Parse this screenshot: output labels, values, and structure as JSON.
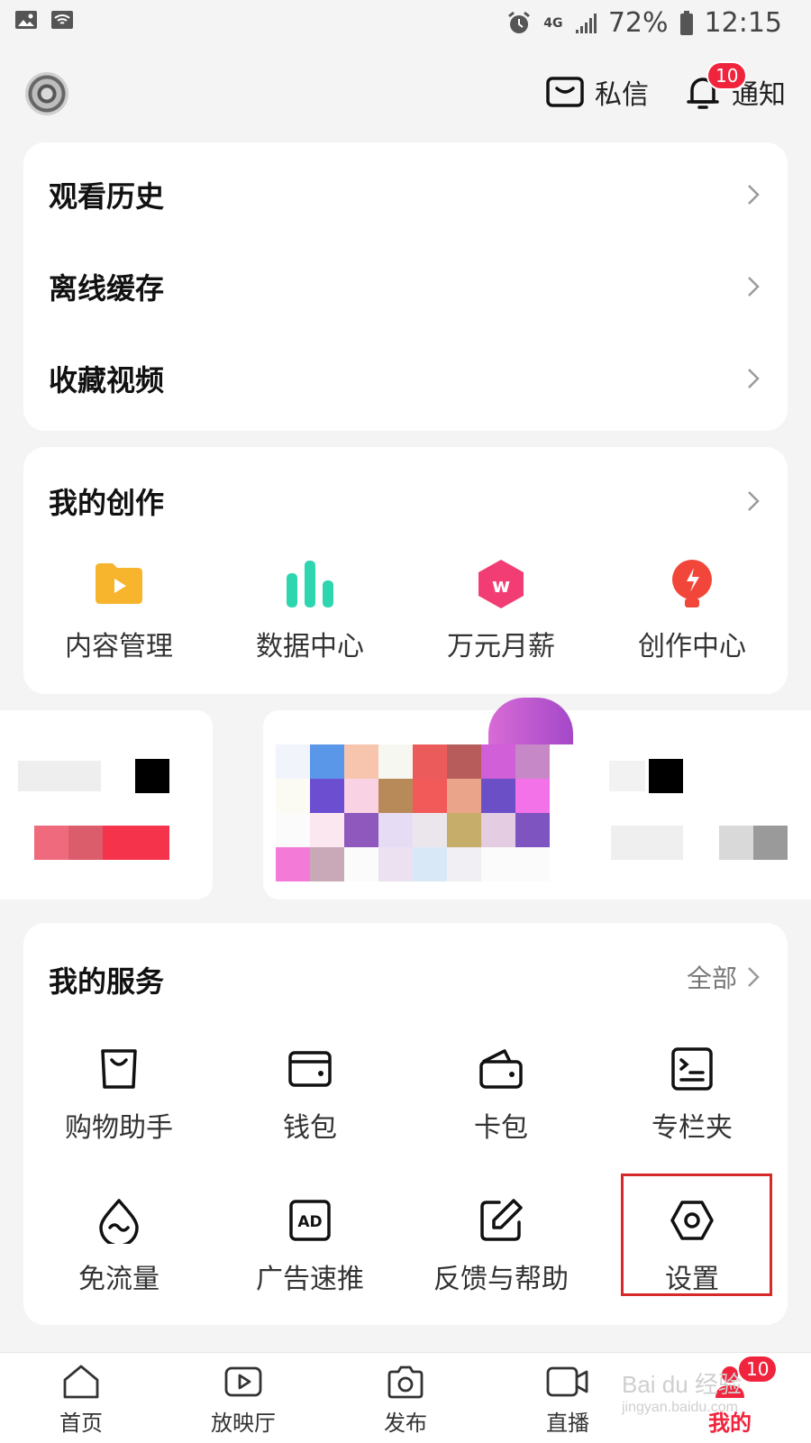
{
  "status_bar": {
    "battery": "72%",
    "time": "12:15",
    "network": "4G"
  },
  "header": {
    "messages_label": "私信",
    "notifications_label": "通知",
    "notifications_badge": "10"
  },
  "history_card": {
    "items": [
      {
        "label": "观看历史"
      },
      {
        "label": "离线缓存"
      },
      {
        "label": "收藏视频"
      }
    ]
  },
  "creation": {
    "title": "我的创作",
    "items": [
      {
        "label": "内容管理",
        "icon": "folder-play-icon",
        "color": "#f7b52e"
      },
      {
        "label": "数据中心",
        "icon": "bar-chart-icon",
        "color": "#2ed6b0"
      },
      {
        "label": "万元月薪",
        "icon": "w-hexagon-icon",
        "color": "#f23d74"
      },
      {
        "label": "创作中心",
        "icon": "lightbulb-icon",
        "color": "#f2463a"
      }
    ]
  },
  "services": {
    "title": "我的服务",
    "all_label": "全部",
    "items": [
      {
        "label": "购物助手",
        "icon": "shopping-bag-icon"
      },
      {
        "label": "钱包",
        "icon": "wallet-icon"
      },
      {
        "label": "卡包",
        "icon": "card-wallet-icon"
      },
      {
        "label": "专栏夹",
        "icon": "column-folder-icon"
      },
      {
        "label": "免流量",
        "icon": "water-drop-icon"
      },
      {
        "label": "广告速推",
        "icon": "ad-icon"
      },
      {
        "label": "反馈与帮助",
        "icon": "edit-icon"
      },
      {
        "label": "设置",
        "icon": "hexagon-settings-icon"
      }
    ]
  },
  "tab_bar": {
    "items": [
      {
        "label": "首页",
        "icon": "home-icon"
      },
      {
        "label": "放映厅",
        "icon": "play-screen-icon"
      },
      {
        "label": "发布",
        "icon": "camera-icon"
      },
      {
        "label": "直播",
        "icon": "video-camera-icon"
      },
      {
        "label": "我的",
        "icon": "profile-icon",
        "badge": "10",
        "active": true
      }
    ]
  },
  "watermark": {
    "text": "Bai du 经验",
    "url": "jingyan.baidu.com"
  },
  "colors": {
    "accent": "#f0243d",
    "highlight": "#d62a2a"
  }
}
